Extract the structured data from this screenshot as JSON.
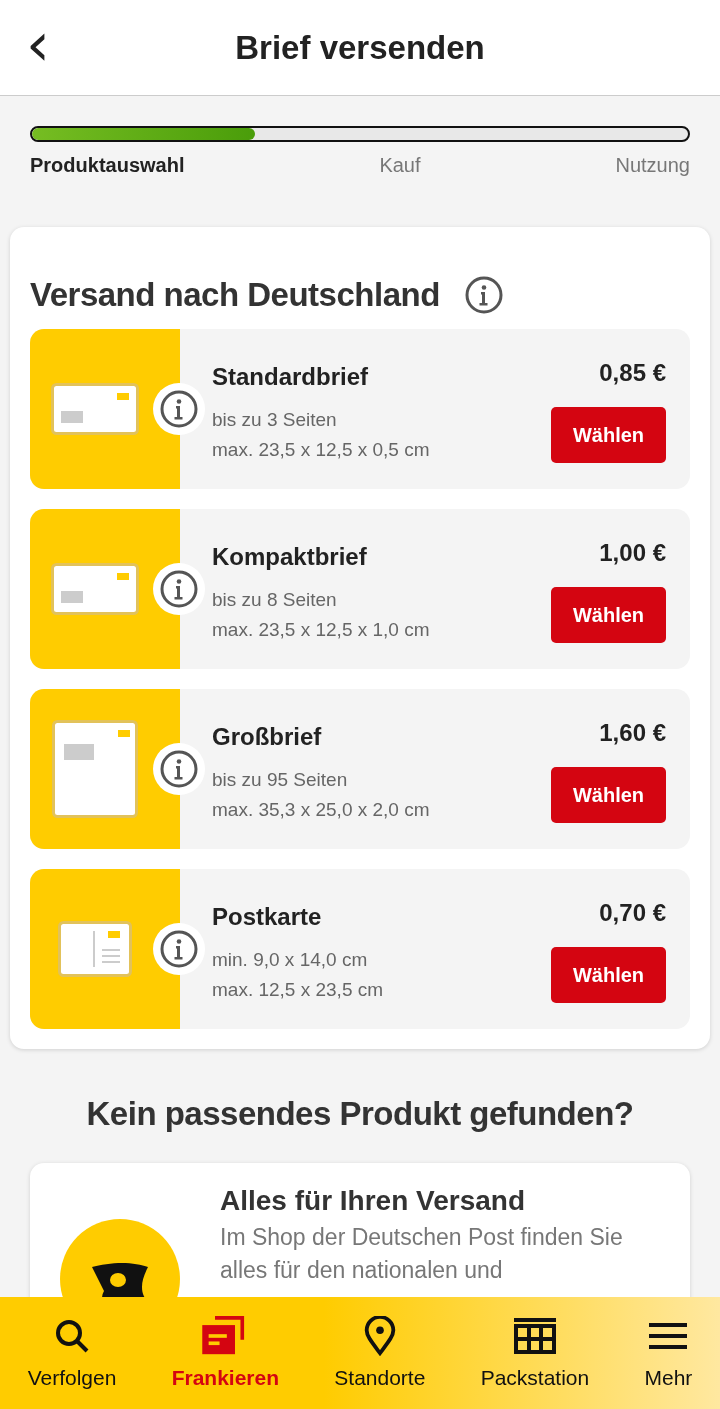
{
  "header": {
    "back": "‹",
    "title": "Brief versenden"
  },
  "progress": {
    "level": 0.34,
    "steps": [
      {
        "label": "Produktauswahl",
        "selected": true
      },
      {
        "label": "Kauf",
        "selected": false
      },
      {
        "label": "Nutzung",
        "selected": false
      }
    ]
  },
  "section": {
    "title": "Versand nach Deutschland",
    "products": [
      {
        "kind": "letter",
        "name": "Standardbrief",
        "price": "0,85 €",
        "lines": [
          "bis zu 3 Seiten",
          "max. 23,5 x 12,5 x 0,5 cm"
        ],
        "button": "Wählen"
      },
      {
        "kind": "letter",
        "name": "Kompaktbrief",
        "price": "1,00 €",
        "lines": [
          "bis zu 8 Seiten",
          "max. 23,5 x 12,5 x 1,0 cm"
        ],
        "button": "Wählen"
      },
      {
        "kind": "large",
        "name": "Großbrief",
        "price": "1,60 €",
        "lines": [
          "bis zu 95 Seiten",
          "max. 35,3 x 25,0 x 2,0 cm"
        ],
        "button": "Wählen"
      },
      {
        "kind": "postcard",
        "name": "Postkarte",
        "price": "0,70 €",
        "lines": [
          "min. 9,0 x 14,0 cm",
          "max. 12,5 x 23,5 cm"
        ],
        "button": "Wählen"
      }
    ]
  },
  "more": {
    "heading": "Kein passendes Produkt gefunden?",
    "promo": {
      "title": "Alles für Ihren Versand",
      "text": "Im Shop der Deutschen Post finden Sie alles für den nationalen und"
    }
  },
  "nav": [
    {
      "kind": "search",
      "label": "Verfolgen",
      "selected": false
    },
    {
      "kind": "stamp",
      "label": "Frankieren",
      "selected": true
    },
    {
      "kind": "pin",
      "label": "Standorte",
      "selected": false
    },
    {
      "kind": "locker",
      "label": "Packstation",
      "selected": false
    },
    {
      "kind": "menu",
      "label": "Mehr",
      "selected": false
    }
  ]
}
